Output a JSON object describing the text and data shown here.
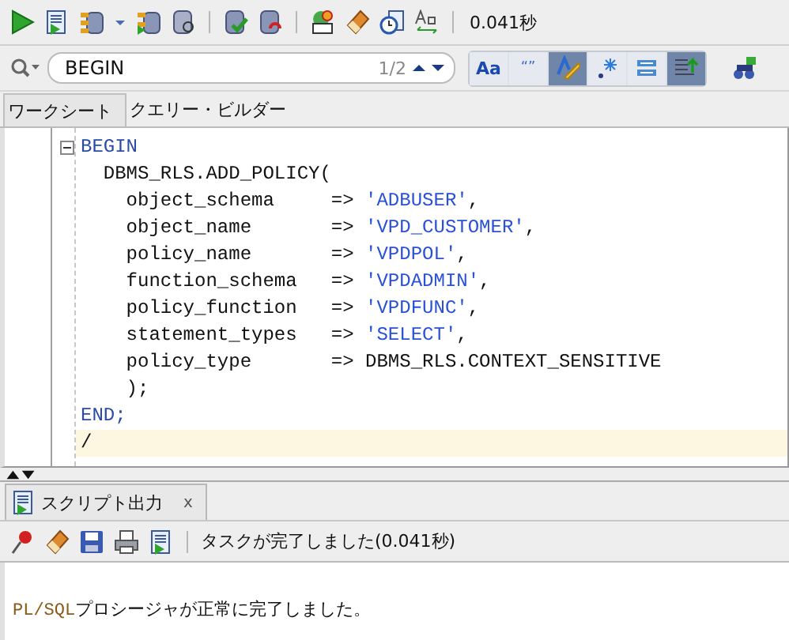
{
  "toolbar": {
    "timing": "0.041秒"
  },
  "search": {
    "value": "BEGIN",
    "count": "1/2",
    "options": [
      {
        "label": "Aa",
        "selected": false
      },
      {
        "label": "“”",
        "selected": false
      },
      {
        "selected": true
      },
      {
        "selected": false
      },
      {
        "selected": false
      },
      {
        "selected": true
      }
    ]
  },
  "tabs": [
    {
      "label": "ワークシート",
      "selected": true
    },
    {
      "label": "クエリー・ビルダー",
      "selected": false
    }
  ],
  "editor": {
    "lines": [
      {
        "fold": true,
        "current": false,
        "segments": [
          {
            "text": "BEGIN",
            "kind": "keyword"
          }
        ]
      },
      {
        "fold": false,
        "current": false,
        "segments": [
          {
            "text": "  DBMS_RLS.ADD_POLICY(",
            "kind": "plain"
          }
        ]
      },
      {
        "fold": false,
        "current": false,
        "segments": [
          {
            "text": "    object_schema     => ",
            "kind": "plain"
          },
          {
            "text": "'ADBUSER'",
            "kind": "string"
          },
          {
            "text": ",",
            "kind": "plain"
          }
        ]
      },
      {
        "fold": false,
        "current": false,
        "segments": [
          {
            "text": "    object_name       => ",
            "kind": "plain"
          },
          {
            "text": "'VPD_CUSTOMER'",
            "kind": "string"
          },
          {
            "text": ",",
            "kind": "plain"
          }
        ]
      },
      {
        "fold": false,
        "current": false,
        "segments": [
          {
            "text": "    policy_name       => ",
            "kind": "plain"
          },
          {
            "text": "'VPDPOL'",
            "kind": "string"
          },
          {
            "text": ",",
            "kind": "plain"
          }
        ]
      },
      {
        "fold": false,
        "current": false,
        "segments": [
          {
            "text": "    function_schema   => ",
            "kind": "plain"
          },
          {
            "text": "'VPDADMIN'",
            "kind": "string"
          },
          {
            "text": ",",
            "kind": "plain"
          }
        ]
      },
      {
        "fold": false,
        "current": false,
        "segments": [
          {
            "text": "    policy_function   => ",
            "kind": "plain"
          },
          {
            "text": "'VPDFUNC'",
            "kind": "string"
          },
          {
            "text": ",",
            "kind": "plain"
          }
        ]
      },
      {
        "fold": false,
        "current": false,
        "segments": [
          {
            "text": "    statement_types   => ",
            "kind": "plain"
          },
          {
            "text": "'SELECT'",
            "kind": "string"
          },
          {
            "text": ",",
            "kind": "plain"
          }
        ]
      },
      {
        "fold": false,
        "current": false,
        "segments": [
          {
            "text": "    policy_type       => DBMS_RLS.CONTEXT_SENSITIVE",
            "kind": "plain"
          }
        ]
      },
      {
        "fold": false,
        "current": false,
        "segments": [
          {
            "text": "    );",
            "kind": "plain"
          }
        ]
      },
      {
        "fold": false,
        "current": false,
        "segments": [
          {
            "text": "END;",
            "kind": "keyword"
          }
        ]
      },
      {
        "fold": false,
        "current": true,
        "segments": [
          {
            "text": "/",
            "kind": "plain"
          }
        ]
      }
    ]
  },
  "output": {
    "tab": {
      "label": "スクリプト出力",
      "close": "x"
    },
    "status": "タスクが完了しました(0.041秒)",
    "message": [
      {
        "text": "PL/SQL",
        "kind": "product"
      },
      {
        "text": "プロシージャが正常に完了しました。",
        "kind": "plain"
      }
    ]
  }
}
